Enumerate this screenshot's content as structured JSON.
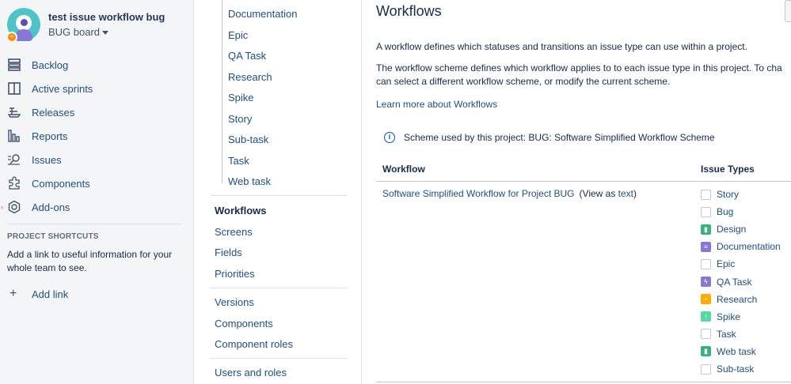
{
  "sidebar": {
    "project_title": "test issue workflow bug",
    "board_label": "BUG board",
    "nav": [
      {
        "label": "Backlog",
        "icon": "backlog-icon"
      },
      {
        "label": "Active sprints",
        "icon": "active-sprints-icon"
      },
      {
        "label": "Releases",
        "icon": "releases-icon"
      },
      {
        "label": "Reports",
        "icon": "reports-icon"
      },
      {
        "label": "Issues",
        "icon": "issues-icon"
      },
      {
        "label": "Components",
        "icon": "components-icon"
      },
      {
        "label": "Add-ons",
        "icon": "add-ons-icon"
      }
    ],
    "shortcuts_heading": "PROJECT SHORTCUTS",
    "shortcuts_text": "Add a link to useful information for your whole team to see.",
    "add_link": "Add link"
  },
  "settings_nav": {
    "issue_types": [
      "Documentation",
      "Epic",
      "QA Task",
      "Research",
      "Spike",
      "Story",
      "Sub-task",
      "Task",
      "Web task"
    ],
    "group_a": [
      "Workflows",
      "Screens",
      "Fields",
      "Priorities"
    ],
    "active": "Workflows",
    "group_b": [
      "Versions",
      "Components",
      "Component roles"
    ],
    "group_c": [
      "Users and roles"
    ]
  },
  "main": {
    "title": "Workflows",
    "description_1": "A workflow defines which statuses and transitions an issue type can use within a project.",
    "description_2_line1": "The workflow scheme defines which workflow applies to to each issue type in this project. To cha",
    "description_2_line2": "can select a different workflow scheme, or modify the current scheme.",
    "learn_more": "Learn more about Workflows",
    "scheme_info": "Scheme used by this project:  BUG: Software Simplified Workflow Scheme",
    "table": {
      "col_workflow": "Workflow",
      "col_issue_types": "Issue Types",
      "workflow_name": "Software Simplified Workflow for Project BUG",
      "view_as_prefix": "(View as ",
      "view_as_link": "text",
      "view_as_suffix": ")",
      "issue_types": [
        {
          "name": "Story",
          "icon": "blank"
        },
        {
          "name": "Bug",
          "icon": "blank"
        },
        {
          "name": "Design",
          "icon": "bookmark",
          "color": "#36b37e"
        },
        {
          "name": "Documentation",
          "icon": "document",
          "color": "#8777d9"
        },
        {
          "name": "Epic",
          "icon": "blank"
        },
        {
          "name": "QA Task",
          "icon": "lightning",
          "color": "#8777d9"
        },
        {
          "name": "Research",
          "icon": "lightbulb",
          "color": "#ffab00"
        },
        {
          "name": "Spike",
          "icon": "arrow-up",
          "color": "#57d9a3"
        },
        {
          "name": "Task",
          "icon": "blank"
        },
        {
          "name": "Web task",
          "icon": "bookmark",
          "color": "#36b37e"
        },
        {
          "name": "Sub-task",
          "icon": "blank"
        }
      ]
    }
  },
  "colors": {
    "link": "#205081",
    "sidebar_bg": "#f4f5f7",
    "text": "#172b4d"
  }
}
